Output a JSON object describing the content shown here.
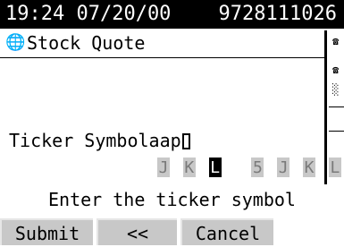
{
  "status": {
    "time": "19:24 07/20/00",
    "phone": "9728111026"
  },
  "app": {
    "icon": "globe-icon",
    "title": "Stock Quote"
  },
  "form": {
    "label": "Ticker Symbol",
    "value": "aap"
  },
  "keypad": {
    "keys": [
      "J",
      "K",
      "L",
      "5",
      "J",
      "K",
      "L"
    ],
    "active_index": 2
  },
  "hint": "Enter the ticker symbol",
  "softkeys": {
    "submit": "Submit",
    "back": "<<",
    "cancel": "Cancel"
  }
}
